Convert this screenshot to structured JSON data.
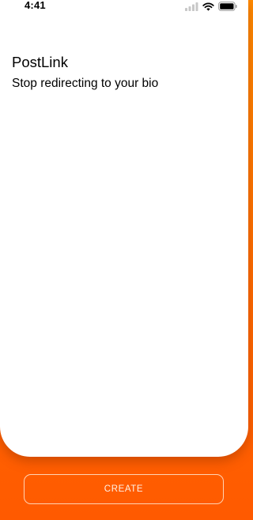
{
  "status_bar": {
    "time": "4:41",
    "icons": [
      "signal-icon",
      "wifi-icon",
      "battery-icon"
    ]
  },
  "header": {
    "title": "PostLink",
    "subtitle": "Stop redirecting to your bio"
  },
  "footer": {
    "create_label": "CREATE"
  },
  "colors": {
    "accent_gradient_top": "#ff8a00",
    "accent_gradient_bottom": "#ff5a00",
    "card_background": "#ffffff",
    "button_text": "#fff1e6"
  }
}
